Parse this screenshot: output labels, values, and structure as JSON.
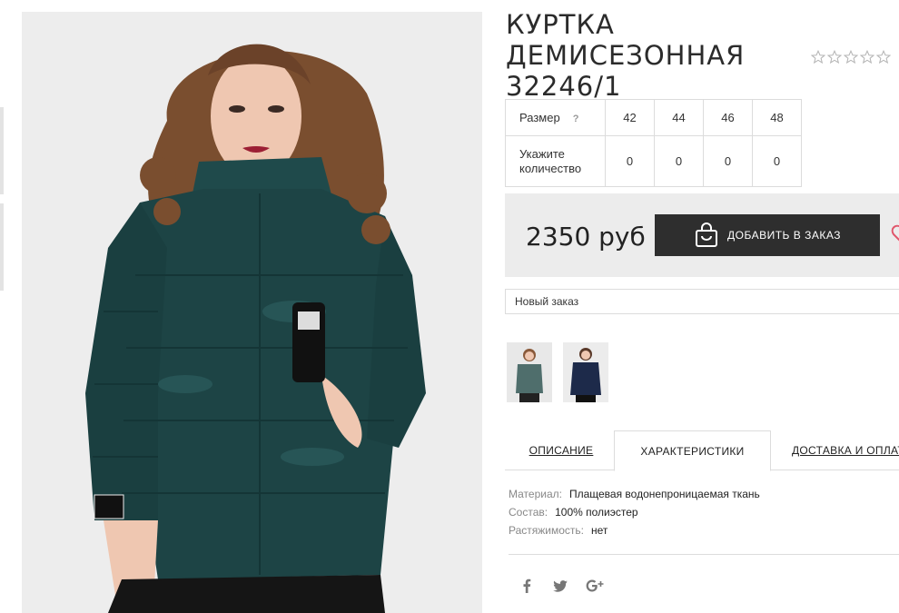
{
  "product": {
    "title": "КУРТКА ДЕМИСЕЗОННАЯ 32246/1",
    "rating": 0,
    "rating_max": 5
  },
  "sizes": {
    "size_label": "Размер",
    "help_icon": "?",
    "qty_label": "Укажите количество",
    "items": [
      {
        "size": "42",
        "qty": "0"
      },
      {
        "size": "44",
        "qty": "0"
      },
      {
        "size": "46",
        "qty": "0"
      },
      {
        "size": "48",
        "qty": "0"
      }
    ]
  },
  "buy": {
    "price": "2350 руб",
    "add_label": "ДОБАВИТЬ В ЗАКАЗ",
    "bag_icon": "shopping-bag-icon",
    "wishlist_icon": "heart-icon"
  },
  "order_select": {
    "value": "Новый заказ"
  },
  "thumbnails": [
    "thumbnail-green-jacket",
    "thumbnail-navy-jacket"
  ],
  "tabs": [
    {
      "label": "ОПИСАНИЕ",
      "active": false
    },
    {
      "label": "ХАРАКТЕРИСТИКИ",
      "active": true
    },
    {
      "label": "ДОСТАВКА И ОПЛАТА",
      "active": false
    }
  ],
  "specs": [
    {
      "key": "Материал:",
      "value": "Плащевая водонепроницаемая ткань"
    },
    {
      "key": "Состав:",
      "value": "100% полиэстер"
    },
    {
      "key": "Растяжимость:",
      "value": "нет"
    }
  ],
  "social": [
    "facebook-icon",
    "twitter-icon",
    "google-plus-icon"
  ],
  "colors": {
    "jacket": "#1d4445",
    "button": "#2e2e2e",
    "buybox": "#ececec",
    "heart": "#e0566b"
  }
}
